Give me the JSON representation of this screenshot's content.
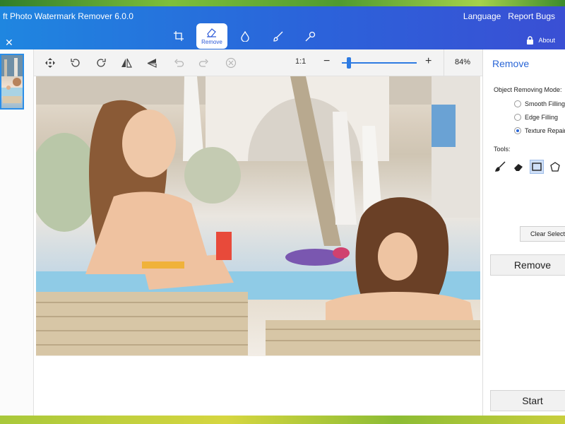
{
  "window": {
    "title": "ft Photo Watermark Remover 6.0.0",
    "links": [
      "Language",
      "Report Bugs"
    ],
    "about_label": "About"
  },
  "top_tools": [
    {
      "icon": "crop-icon",
      "label": ""
    },
    {
      "icon": "eraser-icon",
      "label": "Remove"
    },
    {
      "icon": "drop-icon",
      "label": ""
    },
    {
      "icon": "brush-icon",
      "label": ""
    },
    {
      "icon": "pin-icon",
      "label": ""
    }
  ],
  "toolbar": {
    "ratio_label": "1:1",
    "zoom_minus": "−",
    "zoom_plus": "+",
    "zoom_percent": 84,
    "zoom_text": "84%"
  },
  "panel": {
    "title": "Remove",
    "mode_label": "Object Removing Mode:",
    "modes": [
      {
        "label": "Smooth Filling",
        "selected": false
      },
      {
        "label": "Edge Filling",
        "selected": false
      },
      {
        "label": "Texture Repair",
        "selected": true
      }
    ],
    "tools_label": "Tools:",
    "tools": [
      "brush-icon",
      "eraser-icon",
      "rectangle-icon",
      "polygon-icon"
    ],
    "selected_tool": "rectangle-icon",
    "clear_label": "Clear Selected",
    "remove_label": "Remove",
    "start_label": "Start"
  },
  "colors": {
    "accent": "#2a66d6",
    "title_gradient_start": "#1f86e0",
    "title_gradient_end": "#3a4fd4"
  }
}
